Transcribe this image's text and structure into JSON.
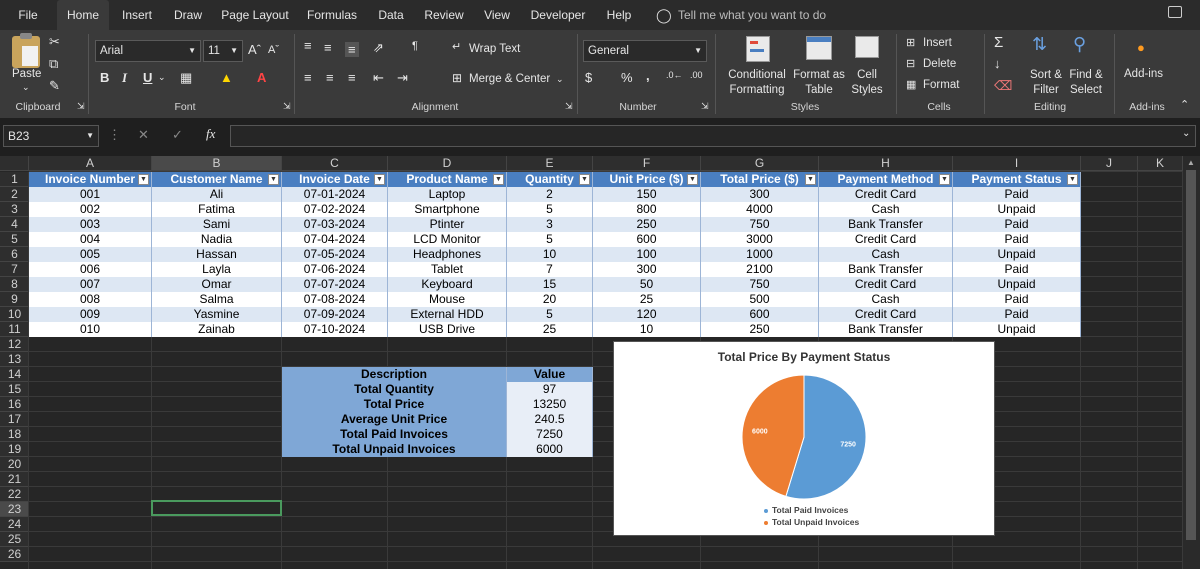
{
  "tabs": [
    "File",
    "Home",
    "Insert",
    "Draw",
    "Page Layout",
    "Formulas",
    "Data",
    "Review",
    "View",
    "Developer",
    "Help"
  ],
  "tell_me": "Tell me what you want to do",
  "ribbon": {
    "paste": "Paste",
    "clipboard": "Clipboard",
    "font_name": "Arial",
    "font_size": "11",
    "font": "Font",
    "wrap_text": "Wrap Text",
    "merge_center": "Merge & Center",
    "alignment": "Alignment",
    "number_format": "General",
    "number": "Number",
    "conditional_formatting": [
      "Conditional",
      "Formatting"
    ],
    "format_as_table": [
      "Format as",
      "Table"
    ],
    "cell_styles": [
      "Cell",
      "Styles"
    ],
    "styles": "Styles",
    "insert": "Insert",
    "delete": "Delete",
    "format": "Format",
    "cells": "Cells",
    "sort_filter": [
      "Sort &",
      "Filter"
    ],
    "find_select": [
      "Find &",
      "Select"
    ],
    "editing": "Editing",
    "addins_btn": "Add-ins",
    "addins": "Add-ins",
    "bold": "B",
    "italic": "I",
    "underline": "U",
    "percent": "%",
    "comma": ","
  },
  "formula_bar": {
    "name_box": "B23",
    "fx": "fx",
    "value": ""
  },
  "columns": [
    "A",
    "B",
    "C",
    "D",
    "E",
    "F",
    "G",
    "H",
    "I",
    "J",
    "K"
  ],
  "rows": [
    "1",
    "2",
    "3",
    "4",
    "5",
    "6",
    "7",
    "8",
    "9",
    "10",
    "11",
    "12",
    "13",
    "14",
    "15",
    "16",
    "17",
    "18",
    "19",
    "20",
    "21",
    "22",
    "23",
    "24",
    "25",
    "26"
  ],
  "table": {
    "headers": [
      "Invoice Number",
      "Customer Name",
      "Invoice Date",
      "Product Name",
      "Quantity",
      "Unit Price ($)",
      "Total Price ($)",
      "Payment Method",
      "Payment Status"
    ],
    "rows": [
      [
        "001",
        "Ali",
        "07-01-2024",
        "Laptop",
        "2",
        "150",
        "300",
        "Credit Card",
        "Paid"
      ],
      [
        "002",
        "Fatima",
        "07-02-2024",
        "Smartphone",
        "5",
        "800",
        "4000",
        "Cash",
        "Unpaid"
      ],
      [
        "003",
        "Sami",
        "07-03-2024",
        "Ptinter",
        "3",
        "250",
        "750",
        "Bank Transfer",
        "Paid"
      ],
      [
        "004",
        "Nadia",
        "07-04-2024",
        "LCD Monitor",
        "5",
        "600",
        "3000",
        "Credit Card",
        "Paid"
      ],
      [
        "005",
        "Hassan",
        "07-05-2024",
        "Headphones",
        "10",
        "100",
        "1000",
        "Cash",
        "Unpaid"
      ],
      [
        "006",
        "Layla",
        "07-06-2024",
        "Tablet",
        "7",
        "300",
        "2100",
        "Bank Transfer",
        "Paid"
      ],
      [
        "007",
        "Omar",
        "07-07-2024",
        "Keyboard",
        "15",
        "50",
        "750",
        "Credit Card",
        "Unpaid"
      ],
      [
        "008",
        "Salma",
        "07-08-2024",
        "Mouse",
        "20",
        "25",
        "500",
        "Cash",
        "Paid"
      ],
      [
        "009",
        "Yasmine",
        "07-09-2024",
        "External HDD",
        "5",
        "120",
        "600",
        "Credit Card",
        "Paid"
      ],
      [
        "010",
        "Zainab",
        "07-10-2024",
        "USB Drive",
        "25",
        "10",
        "250",
        "Bank Transfer",
        "Unpaid"
      ]
    ]
  },
  "summary": {
    "headers": [
      "Description",
      "Value"
    ],
    "rows": [
      [
        "Total Quantity",
        "97"
      ],
      [
        "Total Price",
        "13250"
      ],
      [
        "Average Unit Price",
        "240.5"
      ],
      [
        "Total Paid Invoices",
        "7250"
      ],
      [
        "Total Unpaid Invoices",
        "6000"
      ]
    ]
  },
  "chart_data": {
    "type": "pie",
    "title": "Total Price By Payment Status",
    "categories": [
      "Total Paid Invoices",
      "Total Unpaid Invoices"
    ],
    "values": [
      7250,
      6000
    ],
    "colors": [
      "#5b9bd5",
      "#ed7d31"
    ],
    "legend": "bottom"
  },
  "colors": {
    "header": "#4a7fc1",
    "band": "#dde7f3",
    "summary_header": "#7fa7d6"
  }
}
